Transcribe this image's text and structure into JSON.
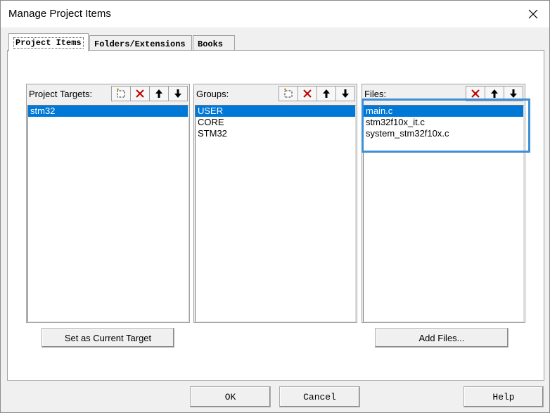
{
  "window": {
    "title": "Manage Project Items",
    "close_icon": "close-icon"
  },
  "tabs": [
    {
      "label": "Project Items",
      "active": true
    },
    {
      "label": "Folders/Extensions",
      "active": false
    },
    {
      "label": "Books",
      "active": false
    }
  ],
  "targets": {
    "label": "Project Targets:",
    "items": [
      {
        "text": "stm32",
        "selected": true
      }
    ]
  },
  "groups": {
    "label": "Groups:",
    "items": [
      {
        "text": "USER",
        "selected": true
      },
      {
        "text": "CORE",
        "selected": false
      },
      {
        "text": "STM32",
        "selected": false
      }
    ]
  },
  "files": {
    "label": "Files:",
    "items": [
      {
        "text": "main.c",
        "selected": true
      },
      {
        "text": "stm32f10x_it.c",
        "selected": false
      },
      {
        "text": "system_stm32f10x.c",
        "selected": false
      }
    ]
  },
  "buttons": {
    "set_current_target": "Set as Current Target",
    "add_files": "Add Files...",
    "ok": "OK",
    "cancel": "Cancel",
    "help": "Help"
  },
  "colors": {
    "selection": "#0078d7",
    "highlight_box": "#3d8fd6",
    "delete_icon": "#c00000"
  }
}
